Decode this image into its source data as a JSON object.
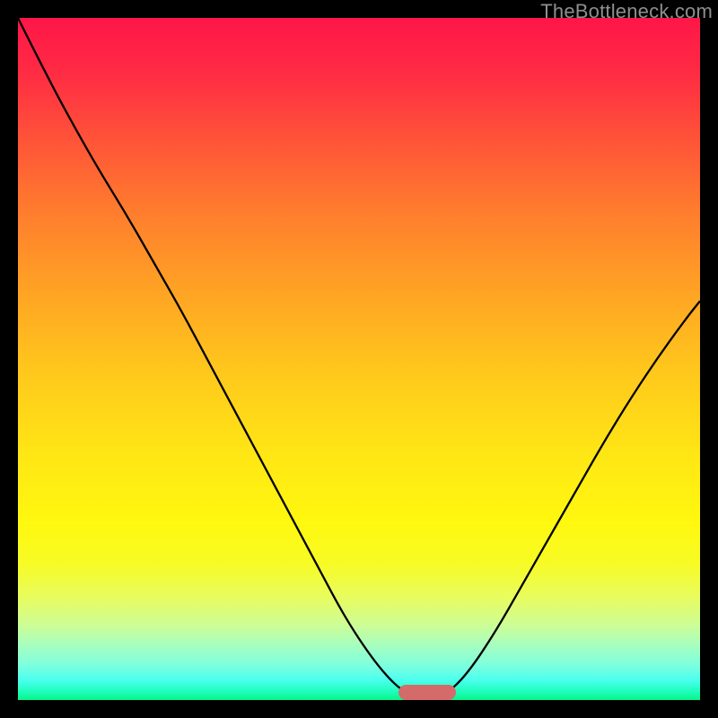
{
  "watermark": "TheBottleneck.com",
  "colors": {
    "background": "#000000",
    "gradient_top": "#ff1648",
    "gradient_bottom": "#06f58b",
    "curve": "#000000",
    "marker": "#d46a6a"
  },
  "chart_data": {
    "type": "line",
    "title": "",
    "xlabel": "",
    "ylabel": "",
    "x_range": [
      0,
      100
    ],
    "y_range": [
      0,
      100
    ],
    "grid": false,
    "legend": false,
    "series": [
      {
        "name": "bottleneck-curve",
        "x": [
          0,
          4,
          8,
          12,
          16,
          20,
          24,
          28,
          32,
          36,
          40,
          44,
          48,
          52,
          55,
          57,
          59,
          61,
          63,
          66,
          70,
          74,
          78,
          82,
          86,
          90,
          94,
          98,
          100
        ],
        "values": [
          100,
          92,
          84.5,
          77.5,
          71,
          64,
          57,
          49.5,
          42,
          34.5,
          27,
          19.5,
          12,
          6,
          2.5,
          1,
          0,
          0,
          1,
          4,
          10,
          17,
          24,
          31,
          38,
          44.5,
          50.5,
          56,
          58.5
        ]
      }
    ],
    "marker": {
      "center_x": 60,
      "y": 0,
      "width_pct": 8.3,
      "height_pct": 2.2
    }
  }
}
